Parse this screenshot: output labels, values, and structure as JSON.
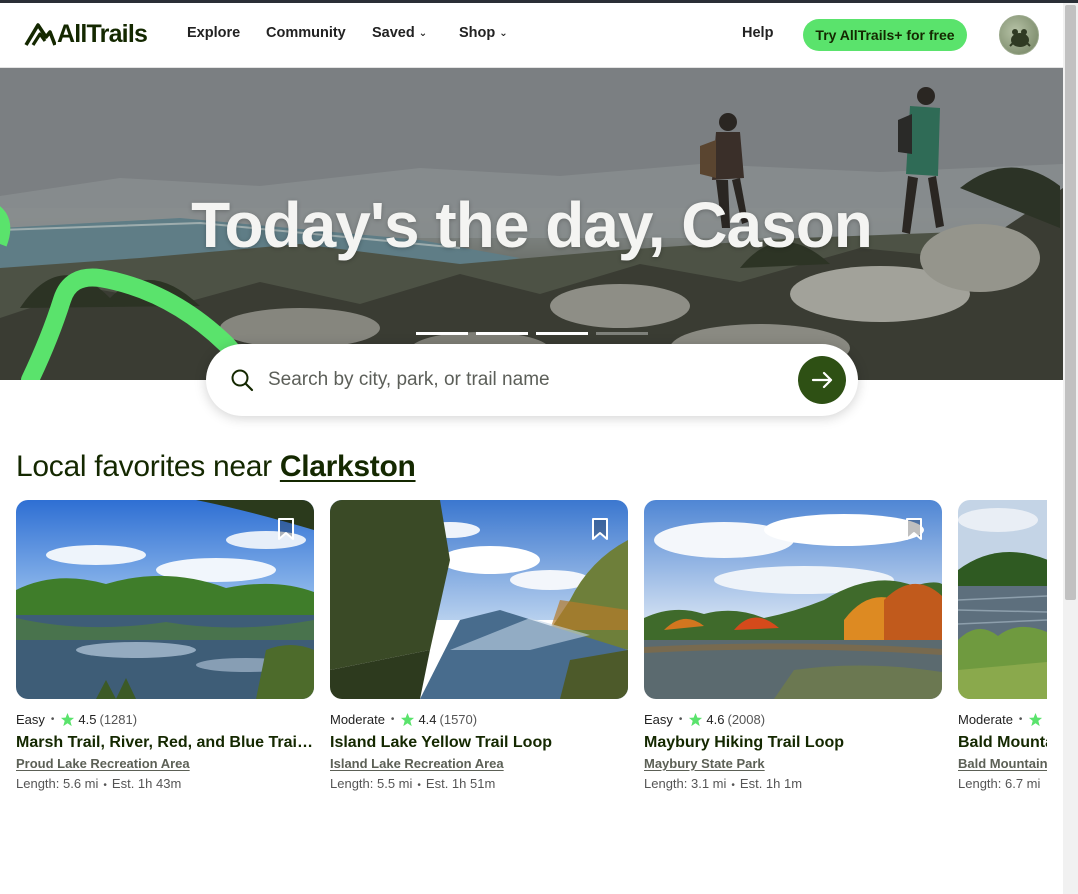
{
  "brand": {
    "name": "AllTrails",
    "accent": "#5ae36c",
    "dark_green": "#2e5014",
    "text": "#142800"
  },
  "nav": {
    "explore": "Explore",
    "community": "Community",
    "saved": "Saved",
    "shop": "Shop",
    "help": "Help",
    "cta": "Try AllTrails+ for free"
  },
  "hero": {
    "title": "Today's the day, Cason",
    "slides_total": 4,
    "slide_active": 3
  },
  "search": {
    "placeholder": "Search by city, park, or trail name",
    "value": ""
  },
  "section": {
    "prefix": "Local favorites near ",
    "place": "Clarkston"
  },
  "cards": [
    {
      "difficulty": "Easy",
      "rating": "4.5",
      "reviews": "(1281)",
      "title": "Marsh Trail, River, Red, and Blue Trail Loop",
      "area": "Proud Lake Recreation Area",
      "length": "Length: 5.6 mi",
      "time": "Est. 1h 43m"
    },
    {
      "difficulty": "Moderate",
      "rating": "4.4",
      "reviews": "(1570)",
      "title": "Island Lake Yellow Trail Loop",
      "area": "Island Lake Recreation Area",
      "length": "Length: 5.5 mi",
      "time": "Est. 1h 51m"
    },
    {
      "difficulty": "Easy",
      "rating": "4.6",
      "reviews": "(2008)",
      "title": "Maybury Hiking Trail Loop",
      "area": "Maybury State Park",
      "length": "Length: 3.1 mi",
      "time": "Est. 1h 1m"
    },
    {
      "difficulty": "Moderate",
      "rating": "",
      "reviews": "",
      "title": "Bald Mountain",
      "area": "Bald Mountain",
      "length": "Length: 6.7 mi",
      "time": ""
    }
  ]
}
